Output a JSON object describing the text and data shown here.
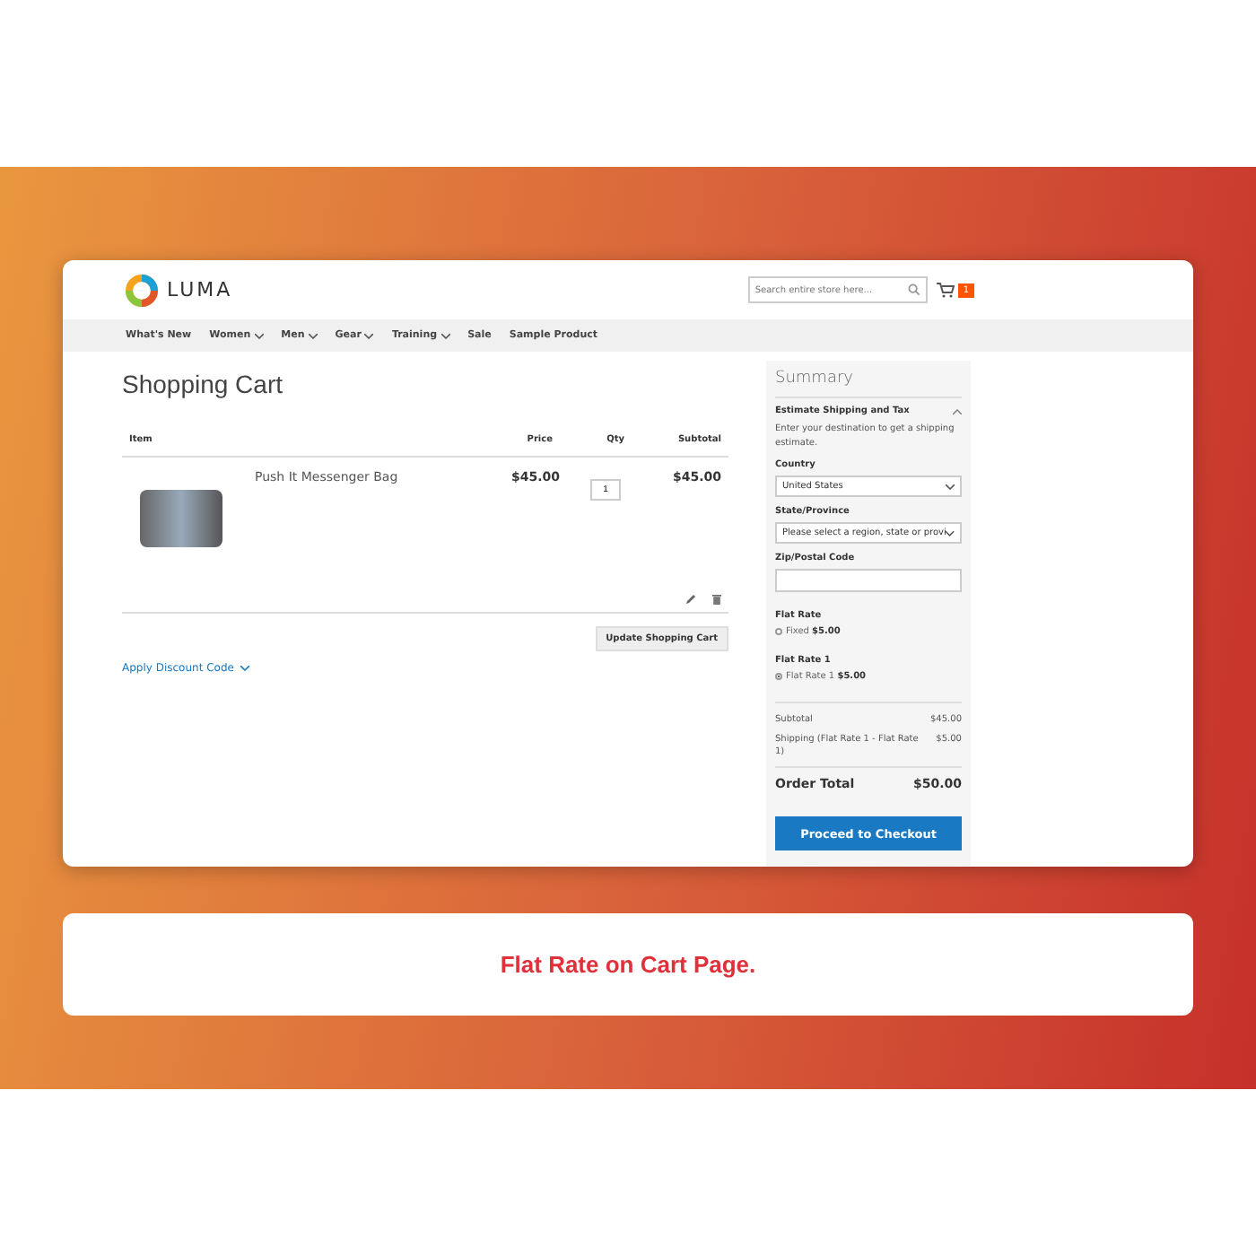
{
  "header": {
    "logo_text": "LUMA",
    "search": {
      "placeholder": "Search entire store here..."
    },
    "cart_count": "1"
  },
  "nav": [
    {
      "label": "What's New",
      "has_menu": false
    },
    {
      "label": "Women",
      "has_menu": true
    },
    {
      "label": "Men",
      "has_menu": true
    },
    {
      "label": "Gear",
      "has_menu": true
    },
    {
      "label": "Training",
      "has_menu": true
    },
    {
      "label": "Sale",
      "has_menu": false
    },
    {
      "label": "Sample Product",
      "has_menu": false
    }
  ],
  "cart": {
    "title": "Shopping Cart",
    "columns": [
      "Item",
      "Price",
      "Qty",
      "Subtotal"
    ],
    "rows": [
      {
        "name": "Push It Messenger Bag",
        "price": "$45.00",
        "qty": "1",
        "subtotal": "$45.00"
      }
    ],
    "update_button": "Update Shopping Cart",
    "discount": {
      "label": "Apply Discount Code",
      "expanded": false
    }
  },
  "summary": {
    "title": "Summary",
    "estimate": {
      "label": "Estimate Shipping and Tax",
      "expanded": true
    },
    "hint": "Enter your destination to get a shipping estimate.",
    "fields": [
      {
        "label": "Country",
        "kind": "select",
        "value": "United States"
      },
      {
        "label": "State/Province",
        "kind": "select",
        "value": "Please select a region, state or provi"
      },
      {
        "label": "Zip/Postal Code",
        "kind": "text"
      }
    ],
    "rates": [
      {
        "carrier": "Flat Rate",
        "option": "Fixed",
        "price": "$5.00",
        "selected": false
      },
      {
        "carrier": "Flat Rate 1",
        "option": "Flat Rate 1",
        "price": "$5.00",
        "selected": true
      }
    ],
    "totals": [
      {
        "label": "Subtotal",
        "value": "$45.00"
      },
      {
        "label": "Shipping (Flat Rate 1 - Flat Rate 1)",
        "value": "$5.00"
      }
    ],
    "order_total": {
      "label": "Order Total",
      "value": "$50.00"
    },
    "checkout_button": "Proceed to Checkout"
  },
  "caption": "Flat Rate on Cart Page."
}
